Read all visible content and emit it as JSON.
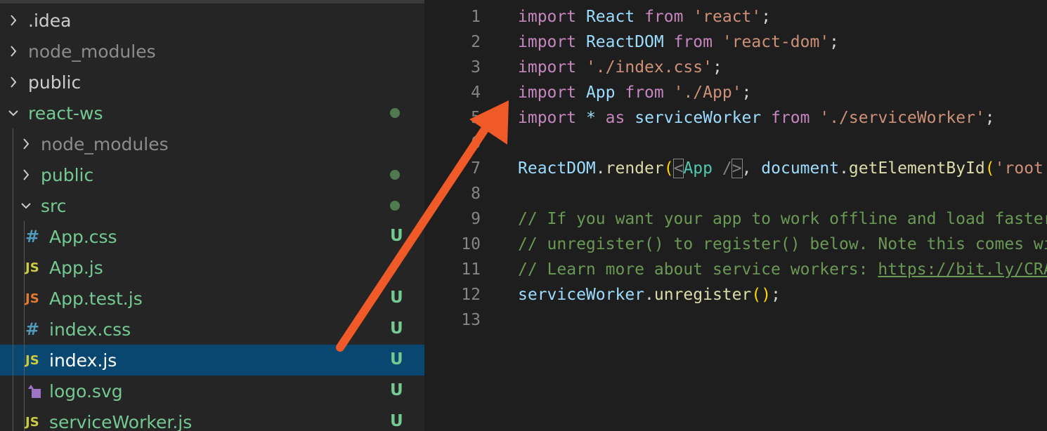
{
  "explorer": {
    "items": [
      {
        "label": ".idea",
        "chevron": "right",
        "color": "#cccccc"
      },
      {
        "label": "node_modules",
        "chevron": "right",
        "color": "#8c8c8c"
      },
      {
        "label": "public",
        "chevron": "right",
        "color": "#cccccc"
      },
      {
        "label": "react-ws",
        "chevron": "down",
        "color": "#73c991"
      },
      {
        "label": "node_modules",
        "chevron": "right",
        "color": "#8c8c8c"
      },
      {
        "label": "public",
        "chevron": "right",
        "color": "#73c991"
      },
      {
        "label": "src",
        "chevron": "down",
        "color": "#73c991"
      },
      {
        "label": "App.css",
        "icon_text": "#",
        "icon": "css-hash-icon",
        "icon_color": "#519aba",
        "color": "#73c991",
        "badge": "U"
      },
      {
        "label": "App.js",
        "icon_text": "JS",
        "icon": "js-file-icon",
        "icon_color": "#cbcb41",
        "color": "#73c991",
        "badge": ""
      },
      {
        "label": "App.test.js",
        "icon_text": "JS",
        "icon": "js-test-file-icon",
        "icon_color": "#e37933",
        "color": "#73c991",
        "badge": "U"
      },
      {
        "label": "index.css",
        "icon_text": "#",
        "icon": "css-hash-icon",
        "icon_color": "#519aba",
        "color": "#73c991",
        "badge": "U"
      },
      {
        "label": "index.js",
        "icon_text": "JS",
        "icon": "js-file-icon",
        "icon_color": "#cbcb41",
        "color": "#ffffff",
        "badge": "U",
        "selected": true
      },
      {
        "label": "logo.svg",
        "icon_text": "",
        "icon": "svg-file-icon",
        "icon_color": "#a074c4",
        "color": "#73c991",
        "badge": "U"
      },
      {
        "label": "serviceWorker.js",
        "icon_text": "JS",
        "icon": "js-file-icon",
        "icon_color": "#cbcb41",
        "color": "#73c991",
        "badge": "U"
      }
    ]
  },
  "editor": {
    "lines": [
      {
        "n": "1",
        "tokens": [
          [
            "kw",
            "import"
          ],
          [
            "pl",
            " "
          ],
          [
            "id",
            "React"
          ],
          [
            "pl",
            " "
          ],
          [
            "kw",
            "from"
          ],
          [
            "pl",
            " "
          ],
          [
            "str",
            "'react'"
          ],
          [
            "pl",
            ";"
          ]
        ]
      },
      {
        "n": "2",
        "tokens": [
          [
            "kw",
            "import"
          ],
          [
            "pl",
            " "
          ],
          [
            "id",
            "ReactDOM"
          ],
          [
            "pl",
            " "
          ],
          [
            "kw",
            "from"
          ],
          [
            "pl",
            " "
          ],
          [
            "str",
            "'react-dom'"
          ],
          [
            "pl",
            ";"
          ]
        ]
      },
      {
        "n": "3",
        "tokens": [
          [
            "kw",
            "import"
          ],
          [
            "pl",
            " "
          ],
          [
            "str",
            "'./index.css'"
          ],
          [
            "pl",
            ";"
          ]
        ]
      },
      {
        "n": "4",
        "tokens": [
          [
            "kw",
            "import"
          ],
          [
            "pl",
            " "
          ],
          [
            "id",
            "App"
          ],
          [
            "pl",
            " "
          ],
          [
            "kw",
            "from"
          ],
          [
            "pl",
            " "
          ],
          [
            "str",
            "'./App'"
          ],
          [
            "pl",
            ";"
          ]
        ]
      },
      {
        "n": "5",
        "tokens": [
          [
            "kw",
            "import"
          ],
          [
            "pl",
            " "
          ],
          [
            "id",
            "*"
          ],
          [
            "pl",
            " "
          ],
          [
            "kw",
            "as"
          ],
          [
            "pl",
            " "
          ],
          [
            "id",
            "serviceWorker"
          ],
          [
            "pl",
            " "
          ],
          [
            "kw",
            "from"
          ],
          [
            "pl",
            " "
          ],
          [
            "str",
            "'./serviceWorker'"
          ],
          [
            "pl",
            ";"
          ]
        ]
      },
      {
        "n": "6",
        "tokens": []
      },
      {
        "n": "7",
        "tokens": [
          [
            "id",
            "ReactDOM"
          ],
          [
            "pl",
            "."
          ],
          [
            "fn",
            "render"
          ],
          [
            "paren",
            "("
          ],
          [
            "tagc bm",
            "<"
          ],
          [
            "cls",
            "App"
          ],
          [
            "pl",
            " "
          ],
          [
            "tagc",
            "/"
          ],
          [
            "tagc bm",
            ">"
          ],
          [
            "pl",
            ", "
          ],
          [
            "id",
            "document"
          ],
          [
            "pl",
            "."
          ],
          [
            "fn",
            "getElementById"
          ],
          [
            "paren",
            "("
          ],
          [
            "str",
            "'root'"
          ],
          [
            "paren",
            ")"
          ],
          [
            "paren",
            ")"
          ],
          [
            "pl",
            ";"
          ]
        ]
      },
      {
        "n": "8",
        "tokens": []
      },
      {
        "n": "9",
        "tokens": [
          [
            "cm",
            "// If you want your app to work offline and load faster, you can change"
          ]
        ]
      },
      {
        "n": "10",
        "tokens": [
          [
            "cm",
            "// unregister() to register() below. Note this comes with some pitfalls."
          ]
        ]
      },
      {
        "n": "11",
        "tokens": [
          [
            "cm",
            "// Learn more about service workers: "
          ],
          [
            "cmlink",
            "https://bit.ly/CRA-PWA"
          ]
        ]
      },
      {
        "n": "12",
        "tokens": [
          [
            "id",
            "serviceWorker"
          ],
          [
            "pl",
            "."
          ],
          [
            "fn",
            "unregister"
          ],
          [
            "paren",
            "()"
          ],
          [
            "pl",
            ";"
          ]
        ]
      },
      {
        "n": "13",
        "tokens": []
      }
    ]
  },
  "annotation": {
    "arrow": "red-arrow-annotation",
    "color": "#f05a28"
  }
}
